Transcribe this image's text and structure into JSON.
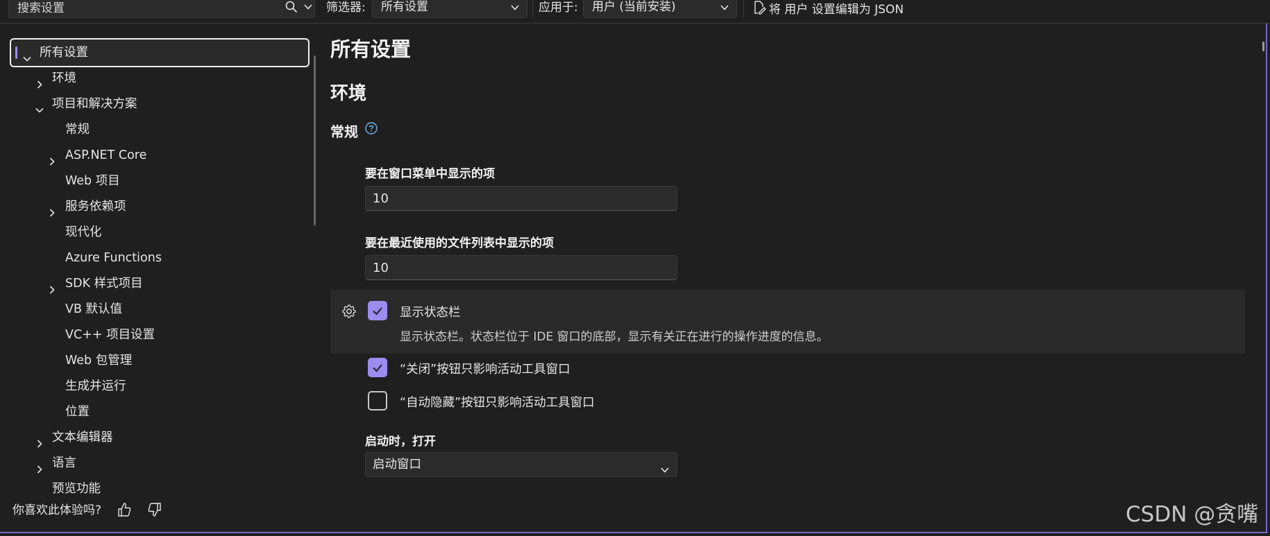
{
  "toolbar": {
    "search_placeholder": "搜索设置",
    "filter_label": "筛选器:",
    "filter_value": "所有设置",
    "apply_label": "应用于:",
    "apply_value": "用户 (当前安装)",
    "edit_json_label": "将 用户 设置编辑为 JSON"
  },
  "sidebar": {
    "items": [
      {
        "label": "所有设置",
        "level": 0,
        "chevron": "down",
        "selected": true
      },
      {
        "label": "环境",
        "level": 1,
        "chevron": "right"
      },
      {
        "label": "项目和解决方案",
        "level": 1,
        "chevron": "down"
      },
      {
        "label": "常规",
        "level": 2,
        "chevron": "none"
      },
      {
        "label": "ASP.NET Core",
        "level": 2,
        "chevron": "right"
      },
      {
        "label": "Web 项目",
        "level": 2,
        "chevron": "none"
      },
      {
        "label": "服务依赖项",
        "level": 2,
        "chevron": "right"
      },
      {
        "label": "现代化",
        "level": 2,
        "chevron": "none"
      },
      {
        "label": "Azure Functions",
        "level": 2,
        "chevron": "none"
      },
      {
        "label": "SDK 样式项目",
        "level": 2,
        "chevron": "right"
      },
      {
        "label": "VB 默认值",
        "level": 2,
        "chevron": "none"
      },
      {
        "label": "VC++ 项目设置",
        "level": 2,
        "chevron": "none"
      },
      {
        "label": "Web 包管理",
        "level": 2,
        "chevron": "none"
      },
      {
        "label": "生成并运行",
        "level": 2,
        "chevron": "none"
      },
      {
        "label": "位置",
        "level": 2,
        "chevron": "none"
      },
      {
        "label": "文本编辑器",
        "level": 1,
        "chevron": "right"
      },
      {
        "label": "语言",
        "level": 1,
        "chevron": "right"
      },
      {
        "label": "预览功能",
        "level": 1,
        "chevron": "none"
      }
    ],
    "feedback_text": "你喜欢此体验吗?"
  },
  "main": {
    "title": "所有设置",
    "section": "环境",
    "subsection": "常规",
    "window_menu_label": "要在窗口菜单中显示的项",
    "window_menu_value": "10",
    "recent_files_label": "要在最近使用的文件列表中显示的项",
    "recent_files_value": "10",
    "status_bar_label": "显示状态栏",
    "status_bar_desc": "显示状态栏。状态栏位于 IDE 窗口的底部，显示有关正在进行的操作进度的信息。",
    "close_button_label": "“关闭”按钮只影响活动工具窗口",
    "autohide_button_label": "“自动隐藏”按钮只影响活动工具窗口",
    "startup_label": "启动时，打开",
    "startup_value": "启动窗口",
    "status_bar_checked": true,
    "close_button_checked": true,
    "autohide_button_checked": false
  },
  "watermark": "CSDN @贪嘴",
  "colors": {
    "accent": "#9d8cf0",
    "background": "#1f1f1f",
    "input_background": "#2b2b2b"
  }
}
